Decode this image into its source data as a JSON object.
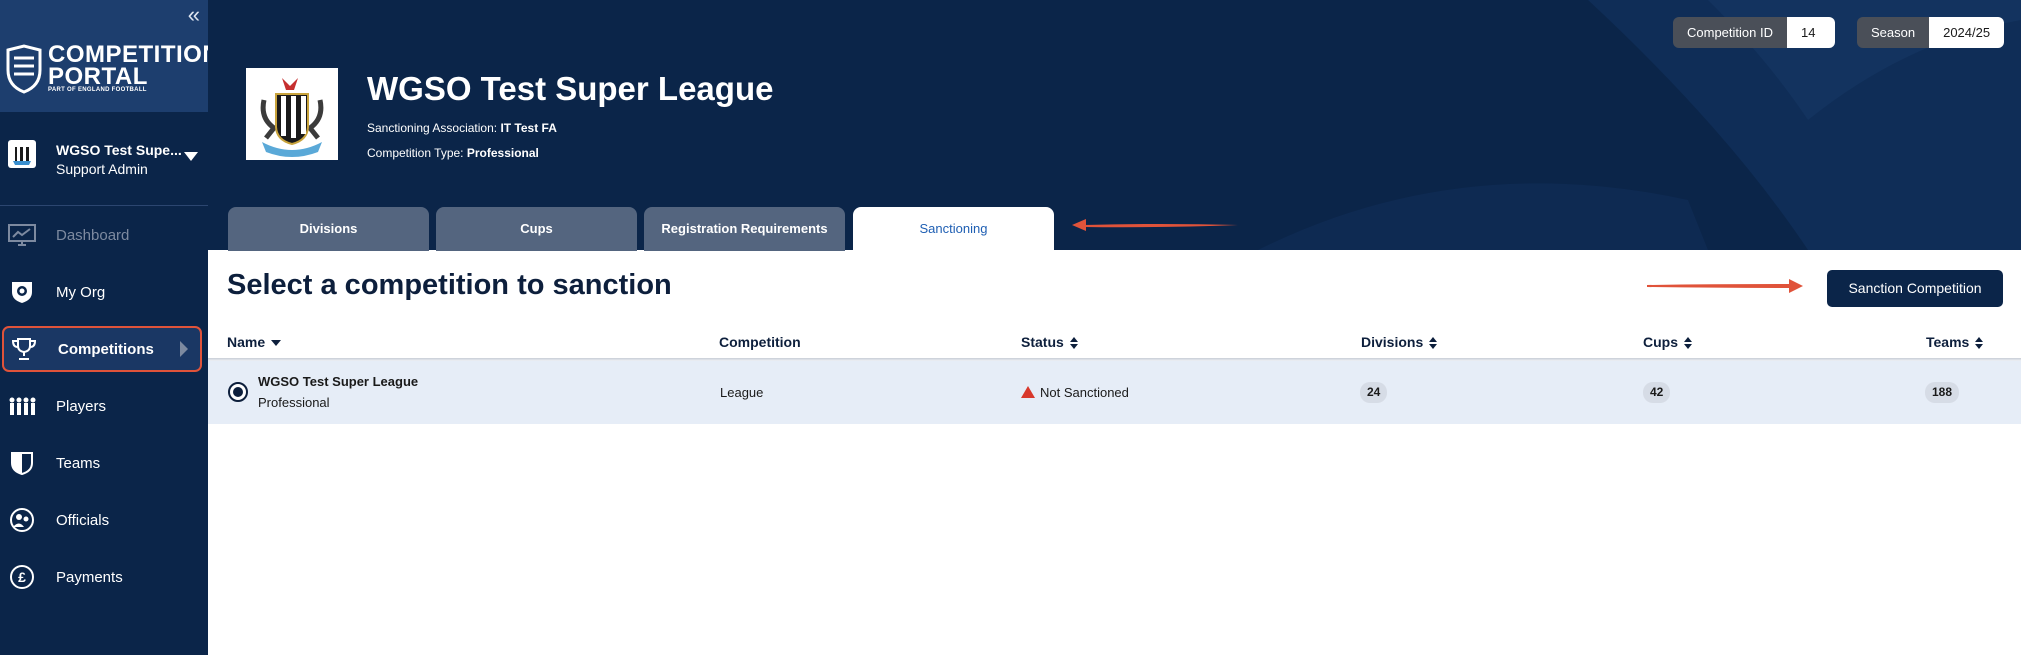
{
  "sidebar": {
    "brand": {
      "title_line1": "COMPETITION",
      "title_line2": "PORTAL",
      "subtitle": "PART OF ENGLAND FOOTBALL"
    },
    "org": {
      "name": "WGSO Test Supe...",
      "role": "Support Admin"
    },
    "items": [
      {
        "label": "Dashboard",
        "icon": "dashboard-icon",
        "state": "disabled"
      },
      {
        "label": "My Org",
        "icon": "shield-icon",
        "state": "normal"
      },
      {
        "label": "Competitions",
        "icon": "trophy-icon",
        "state": "active"
      },
      {
        "label": "Players",
        "icon": "players-icon",
        "state": "normal"
      },
      {
        "label": "Teams",
        "icon": "team-shield-icon",
        "state": "normal"
      },
      {
        "label": "Officials",
        "icon": "officials-icon",
        "state": "normal"
      },
      {
        "label": "Payments",
        "icon": "pound-icon",
        "state": "normal"
      }
    ]
  },
  "header": {
    "title": "WGSO Test Super League",
    "sanctioning_label": "Sanctioning Association:",
    "sanctioning_value": "IT Test FA",
    "type_label": "Competition Type:",
    "type_value": "Professional",
    "competition_id": {
      "label": "Competition ID",
      "value": "14"
    },
    "season": {
      "label": "Season",
      "value": "2024/25"
    },
    "tabs": [
      {
        "label": "Divisions",
        "active": false
      },
      {
        "label": "Cups",
        "active": false
      },
      {
        "label": "Registration Requirements",
        "active": false
      },
      {
        "label": "Sanctioning",
        "active": true
      }
    ]
  },
  "main": {
    "heading": "Select a competition to sanction",
    "action_button": "Sanction Competition",
    "columns": [
      "Name",
      "Competition",
      "Status",
      "Divisions",
      "Cups",
      "Teams"
    ],
    "rows": [
      {
        "name": "WGSO Test Super League",
        "subtype": "Professional",
        "competition": "League",
        "status": "Not Sanctioned",
        "divisions": "24",
        "cups": "42",
        "teams": "188",
        "selected": true
      }
    ]
  },
  "colors": {
    "navy": "#0b2549",
    "sidebar_brand": "#1d3e6e",
    "tab_inactive": "#54657f",
    "tab_active_text": "#1f5fb3",
    "annotation_red": "#e0533a",
    "warning_red": "#d8382c",
    "row_selected": "#e6edf7"
  }
}
